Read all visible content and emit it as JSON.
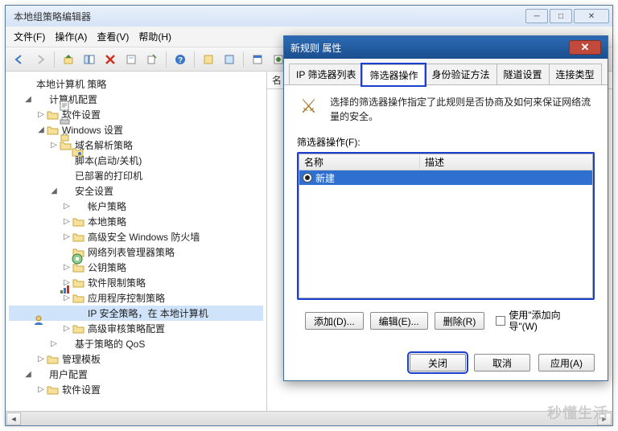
{
  "window": {
    "title": "本地组策略编辑器"
  },
  "menu": {
    "file": "文件(F)",
    "action": "操作(A)",
    "view": "查看(V)",
    "help": "帮助(H)"
  },
  "right_head": "名",
  "tree": {
    "root": "本地计算机 策略",
    "computer_config": "计算机配置",
    "software_settings": "软件设置",
    "windows_settings": "Windows 设置",
    "name_resolution": "域名解析策略",
    "scripts": "脚本(启动/关机)",
    "deployed_printers": "已部署的打印机",
    "security_settings": "安全设置",
    "account_policies": "帐户策略",
    "local_policies": "本地策略",
    "windows_firewall": "高级安全 Windows 防火墙",
    "network_list": "网络列表管理器策略",
    "public_key": "公钥策略",
    "software_restrict": "软件限制策略",
    "app_control": "应用程序控制策略",
    "ip_security": "IP 安全策略，在 本地计算机",
    "audit_policy": "高级审核策略配置",
    "policy_qos": "基于策略的 QoS",
    "admin_templates": "管理模板",
    "user_config": "用户配置",
    "user_software": "软件设置"
  },
  "dialog": {
    "title": "新规则 属性",
    "tabs": {
      "ip_filter_list": "IP 筛选器列表",
      "filter_action": "筛选器操作",
      "auth_methods": "身份验证方法",
      "tunnel_setting": "隧道设置",
      "conn_type": "连接类型"
    },
    "info": "选择的筛选器操作指定了此规则是否协商及如何来保证网络流量的安全。",
    "group_label": "筛选器操作(F):",
    "col_name": "名称",
    "col_desc": "描述",
    "row1_name": "新建",
    "btn_add": "添加(D)...",
    "btn_edit": "编辑(E)...",
    "btn_remove": "删除(R)",
    "chk_wizard": "使用\"添加向导\"(W)",
    "btn_close": "关闭",
    "btn_cancel": "取消",
    "btn_apply": "应用(A)"
  },
  "watermark": "秒懂生活"
}
